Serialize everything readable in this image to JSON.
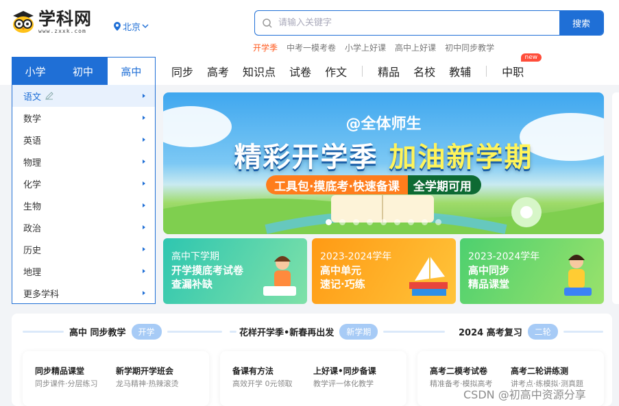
{
  "header": {
    "logo_title": "学科网",
    "logo_sub": "www.zxxk.com",
    "city": "北京",
    "search_placeholder": "请输入关键字",
    "search_button": "搜索",
    "hot_keywords": [
      "开学季",
      "中考一模考卷",
      "小学上好课",
      "高中上好课",
      "初中同步教学"
    ]
  },
  "stage_tabs": [
    "小学",
    "初中",
    "高中"
  ],
  "nav": {
    "group1": [
      "同步",
      "高考",
      "知识点",
      "试卷",
      "作文"
    ],
    "group2": [
      "精品",
      "名校",
      "教辅"
    ],
    "group3": "中职",
    "new_badge": "new"
  },
  "subjects": [
    "语文",
    "数学",
    "英语",
    "物理",
    "化学",
    "生物",
    "政治",
    "历史",
    "地理",
    "更多学科"
  ],
  "banner": {
    "at_line": "@全体师生",
    "title_a": "精彩开学季",
    "title_b": "加油新学期",
    "pill_left": "工具包·摸底考·快速备课",
    "pill_right": "全学期可用",
    "dots": 9,
    "active_dot": 1
  },
  "cards": [
    {
      "l1": "高中下学期",
      "l2": "开学摸底考试卷",
      "l3": "查漏补缺"
    },
    {
      "l1": "2023-2024学年",
      "l2": "高中单元",
      "l3": "速记·巧练"
    },
    {
      "l1": "2023-2024学年",
      "l2": "高中同步",
      "l3": "精品课堂"
    }
  ],
  "sections": [
    {
      "title": "高中 同步教学",
      "badge": "开学",
      "items": [
        {
          "t": "同步精品课堂",
          "s": "同步课件·分层练习"
        },
        {
          "t": "新学期开学班会",
          "s": "龙马精神·热辣滚烫"
        }
      ]
    },
    {
      "title": "花样开学季•新春再出发",
      "badge": "新学期",
      "items": [
        {
          "t": "备课有方法",
          "s": "高效开学 0元领取"
        },
        {
          "t": "上好课•同步备课",
          "s": "教学评一体化教学"
        }
      ]
    },
    {
      "title": "2024 高考复习",
      "badge": "二轮",
      "items": [
        {
          "t": "高考二模考试卷",
          "s": "精准备考·模拟高考"
        },
        {
          "t": "高考二轮讲练测",
          "s": "讲考点·练模拟·测真题"
        }
      ]
    }
  ],
  "watermark": "CSDN @初高中资源分享"
}
